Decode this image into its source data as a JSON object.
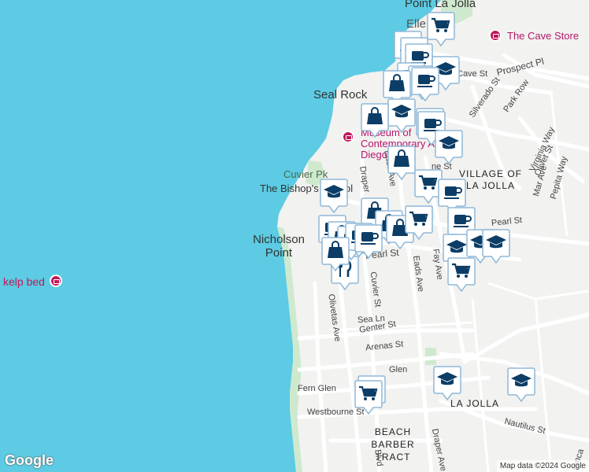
{
  "colors": {
    "water": "#5ccbe3",
    "land": "#f2f2f0",
    "park": "#cfe9cf",
    "road": "#ffffff",
    "marker_bg": "#ffffff",
    "marker_border": "#8fb8d8",
    "marker_icon": "#0b3d66",
    "poi": "#c2185b"
  },
  "places": {
    "point_la_jolla": "Point La Jolla",
    "seal_rock": "Seal Rock",
    "cuvier_pk": "Cuvier Pk",
    "bishops_school": "The Bishop's School",
    "nicholson_point": "Nicholson Point",
    "kelp_bed": "kelp bed",
    "cave_store": "The Cave Store",
    "museum": "Museum of Contemporary Art San Diego",
    "village": "VILLAGE OF LA JOLLA",
    "la_jolla": "LA JOLLA",
    "beach_barber": "BEACH BARBER TRACT"
  },
  "streets": {
    "prospect_pl": "Prospect Pl",
    "cave_st": "Cave St",
    "silverado_st": "Silverado St",
    "park_row": "Park Row",
    "virginia_way": "Virginia Way",
    "olivet_st": "Olivet St",
    "mar_ave": "Mar Ave",
    "pepita_way": "Pepita Way",
    "eads_ave_n": "Eads Ave",
    "draper_n": "Draper",
    "pearl_st": "Pearl St",
    "pearl_st_e": "Pearl St",
    "fay_ave": "Fay Ave",
    "eads_ave_s": "Eads Ave",
    "cuvier_st": "Cuvier St",
    "olivetas_ave": "Olivetas Ave",
    "sea_ln": "Sea Ln",
    "genter_st": "Genter St",
    "arenas_st": "Arenas St",
    "glen": "Glen",
    "fern_glen": "Fern Glen",
    "westbourne": "Westbourne St",
    "nautilus_st": "Nautilus St",
    "draper_ave_s": "Draper Ave",
    "blvd": "Blvd",
    "ranca": "ranca",
    "ellen": "Elle",
    "ne_st": "ne St"
  },
  "markers": [
    {
      "icon": "shopping-cart-icon",
      "label": "grocery"
    },
    {
      "icon": "coffee-icon",
      "label": "cafe"
    },
    {
      "icon": "coffee-icon",
      "label": "cafe"
    },
    {
      "icon": "coffee-icon",
      "label": "cafe"
    },
    {
      "icon": "coffee-icon",
      "label": "cafe"
    },
    {
      "icon": "coffee-icon",
      "label": "cafe"
    },
    {
      "icon": "graduation-cap-icon",
      "label": "school"
    },
    {
      "icon": "shopping-bag-icon",
      "label": "shop"
    },
    {
      "icon": "coffee-icon",
      "label": "cafe"
    },
    {
      "icon": "graduation-cap-icon",
      "label": "school"
    },
    {
      "icon": "shopping-bag-icon",
      "label": "shop"
    },
    {
      "icon": "shopping-cart-icon",
      "label": "grocery"
    },
    {
      "icon": "coffee-icon",
      "label": "cafe"
    },
    {
      "icon": "graduation-cap-icon",
      "label": "school"
    },
    {
      "icon": "shopping-bag-icon",
      "label": "shop"
    },
    {
      "icon": "shopping-bag-icon",
      "label": "shop"
    },
    {
      "icon": "shopping-cart-icon",
      "label": "grocery"
    },
    {
      "icon": "coffee-icon",
      "label": "cafe"
    },
    {
      "icon": "coffee-icon",
      "label": "cafe"
    },
    {
      "icon": "graduation-cap-icon",
      "label": "school"
    },
    {
      "icon": "graduation-cap-icon",
      "label": "school"
    },
    {
      "icon": "shopping-bag-icon",
      "label": "shop"
    },
    {
      "icon": "fork-knife-icon",
      "label": "restaurant"
    },
    {
      "icon": "shopping-cart-icon",
      "label": "grocery"
    },
    {
      "icon": "graduation-cap-icon",
      "label": "school"
    },
    {
      "icon": "graduation-cap-icon",
      "label": "school"
    },
    {
      "icon": "shopping-cart-icon",
      "label": "grocery"
    }
  ],
  "attribution": {
    "logo": "Google",
    "text": "Map data ©2024 Google"
  }
}
